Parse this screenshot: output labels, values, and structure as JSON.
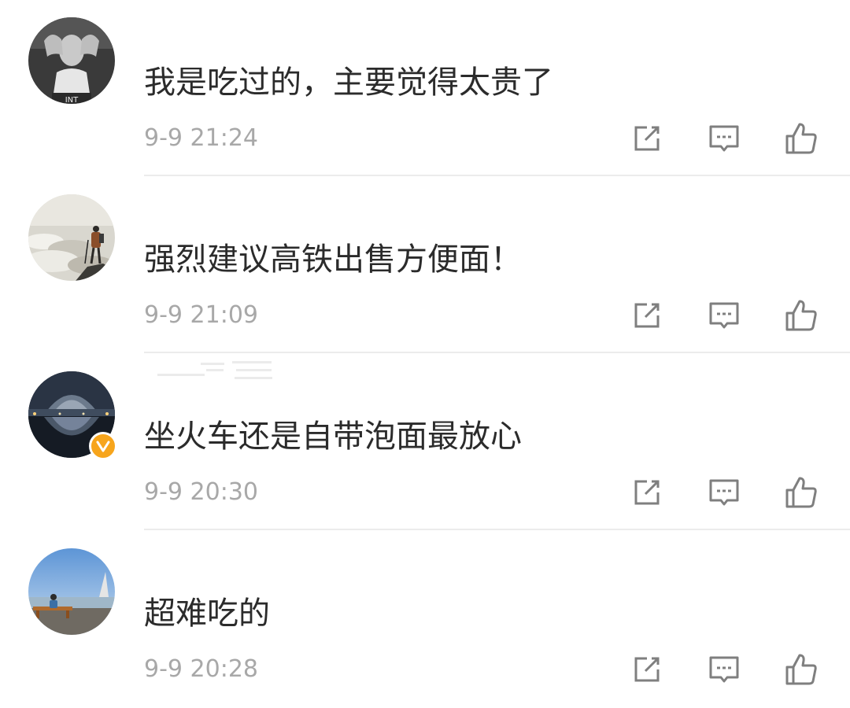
{
  "comments": [
    {
      "text": "我是吃过的，主要觉得太贵了",
      "time": "9-9 21:24",
      "avatar_icon": "person-portrait-avatar",
      "verified": false
    },
    {
      "text": "强烈建议高铁出售方便面！",
      "time": "9-9 21:09",
      "avatar_icon": "hiker-above-clouds-avatar",
      "verified": false
    },
    {
      "text": "坐火车还是自带泡面最放心",
      "time": "9-9 20:30",
      "avatar_icon": "night-building-reflection-avatar",
      "verified": true
    },
    {
      "text": "超难吃的",
      "time": "9-9 20:28",
      "avatar_icon": "seaside-bench-avatar",
      "verified": false
    }
  ],
  "actions": {
    "share_icon": "share-icon",
    "reply_icon": "comment-icon",
    "like_icon": "thumbs-up-icon"
  },
  "colors": {
    "text": "#2b2b2b",
    "timestamp": "#a8a8a8",
    "icon": "#7f7f7f",
    "divider": "#ececec",
    "verified_badge": "#f7a51c"
  }
}
